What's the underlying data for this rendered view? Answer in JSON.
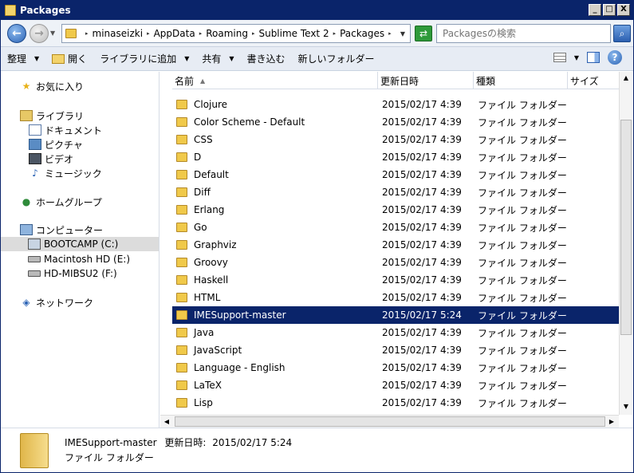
{
  "window": {
    "title": "Packages",
    "min_label": "_",
    "max_label": "□",
    "close_label": "X"
  },
  "address": {
    "back_glyph": "←",
    "forward_glyph": "→",
    "crumbs": [
      "minaseizki",
      "AppData",
      "Roaming",
      "Sublime Text 2",
      "Packages"
    ],
    "refresh_glyph": "⇄",
    "search_placeholder": "Packagesの検索",
    "search_glyph": "⌕"
  },
  "toolbar": {
    "organize": "整理",
    "open": "開く",
    "include_library": "ライブラリに追加",
    "share": "共有",
    "burn": "書き込む",
    "new_folder": "新しいフォルダー",
    "help_glyph": "?"
  },
  "sidebar": {
    "favorites": "お気に入り",
    "libraries": "ライブラリ",
    "documents": "ドキュメント",
    "pictures": "ピクチャ",
    "videos": "ビデオ",
    "music": "ミュージック",
    "homegroup": "ホームグループ",
    "computer": "コンピューター",
    "drive_c": "BOOTCAMP (C:)",
    "drive_e": "Macintosh HD (E:)",
    "drive_f": "HD-MIBSU2 (F:)",
    "network": "ネットワーク"
  },
  "columns": {
    "name": "名前",
    "date": "更新日時",
    "type": "種類",
    "size": "サイズ"
  },
  "files": [
    {
      "name": "Clojure",
      "date": "2015/02/17 4:39",
      "type": "ファイル フォルダー"
    },
    {
      "name": "Color Scheme - Default",
      "date": "2015/02/17 4:39",
      "type": "ファイル フォルダー"
    },
    {
      "name": "CSS",
      "date": "2015/02/17 4:39",
      "type": "ファイル フォルダー"
    },
    {
      "name": "D",
      "date": "2015/02/17 4:39",
      "type": "ファイル フォルダー"
    },
    {
      "name": "Default",
      "date": "2015/02/17 4:39",
      "type": "ファイル フォルダー"
    },
    {
      "name": "Diff",
      "date": "2015/02/17 4:39",
      "type": "ファイル フォルダー"
    },
    {
      "name": "Erlang",
      "date": "2015/02/17 4:39",
      "type": "ファイル フォルダー"
    },
    {
      "name": "Go",
      "date": "2015/02/17 4:39",
      "type": "ファイル フォルダー"
    },
    {
      "name": "Graphviz",
      "date": "2015/02/17 4:39",
      "type": "ファイル フォルダー"
    },
    {
      "name": "Groovy",
      "date": "2015/02/17 4:39",
      "type": "ファイル フォルダー"
    },
    {
      "name": "Haskell",
      "date": "2015/02/17 4:39",
      "type": "ファイル フォルダー"
    },
    {
      "name": "HTML",
      "date": "2015/02/17 4:39",
      "type": "ファイル フォルダー"
    },
    {
      "name": "IMESupport-master",
      "date": "2015/02/17 5:24",
      "type": "ファイル フォルダー",
      "selected": true
    },
    {
      "name": "Java",
      "date": "2015/02/17 4:39",
      "type": "ファイル フォルダー"
    },
    {
      "name": "JavaScript",
      "date": "2015/02/17 4:39",
      "type": "ファイル フォルダー"
    },
    {
      "name": "Language - English",
      "date": "2015/02/17 4:39",
      "type": "ファイル フォルダー"
    },
    {
      "name": "LaTeX",
      "date": "2015/02/17 4:39",
      "type": "ファイル フォルダー"
    },
    {
      "name": "Lisp",
      "date": "2015/02/17 4:39",
      "type": "ファイル フォルダー"
    }
  ],
  "details": {
    "name": "IMESupport-master",
    "modified_label": "更新日時:",
    "modified_value": "2015/02/17 5:24",
    "type": "ファイル フォルダー"
  },
  "colors": {
    "selection": "#0a246a",
    "titlebar": "#0a246a"
  }
}
